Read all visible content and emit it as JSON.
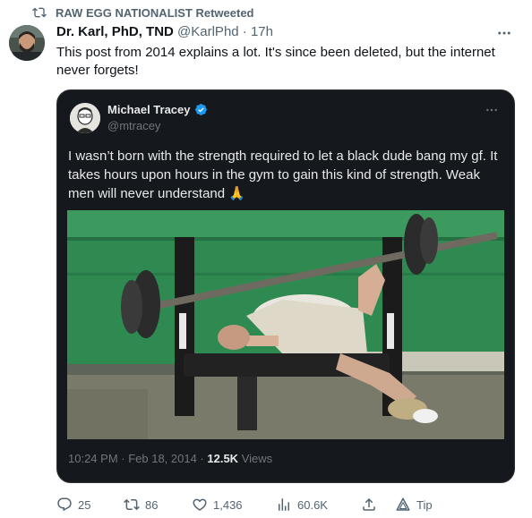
{
  "retweet_header": {
    "text": "RAW EGG NATIONALIST Retweeted"
  },
  "tweet": {
    "display_name": "Dr. Karl, PhD, TND",
    "handle": "@KarlPhd",
    "separator": "·",
    "time": "17h",
    "text": "This post from 2014 explains a lot. It's since been deleted, but the internet never forgets!"
  },
  "quoted_tweet": {
    "display_name": "Michael Tracey",
    "handle": "@mtracey",
    "text": "I wasn’t born with the strength required to let a black dude bang my gf. It takes hours upon hours in the gym to gain this kind of strength. Weak men will never understand 🙏",
    "timestamp": "10:24 PM · Feb 18, 2014 · ",
    "views_count": "12.5K",
    "views_label": " Views",
    "verified": true
  },
  "actions": {
    "replies": "25",
    "retweets": "86",
    "likes": "1,436",
    "views": "60.6K",
    "tip_label": "Tip"
  },
  "colors": {
    "text_primary": "#0f1419",
    "text_secondary": "#536471",
    "quote_bg": "#15181c",
    "verified_blue": "#1d9bf0"
  },
  "icons": [
    "retweet-icon",
    "more-icon",
    "verified-icon",
    "reply-icon",
    "like-icon",
    "views-icon",
    "share-icon",
    "tip-icon"
  ]
}
